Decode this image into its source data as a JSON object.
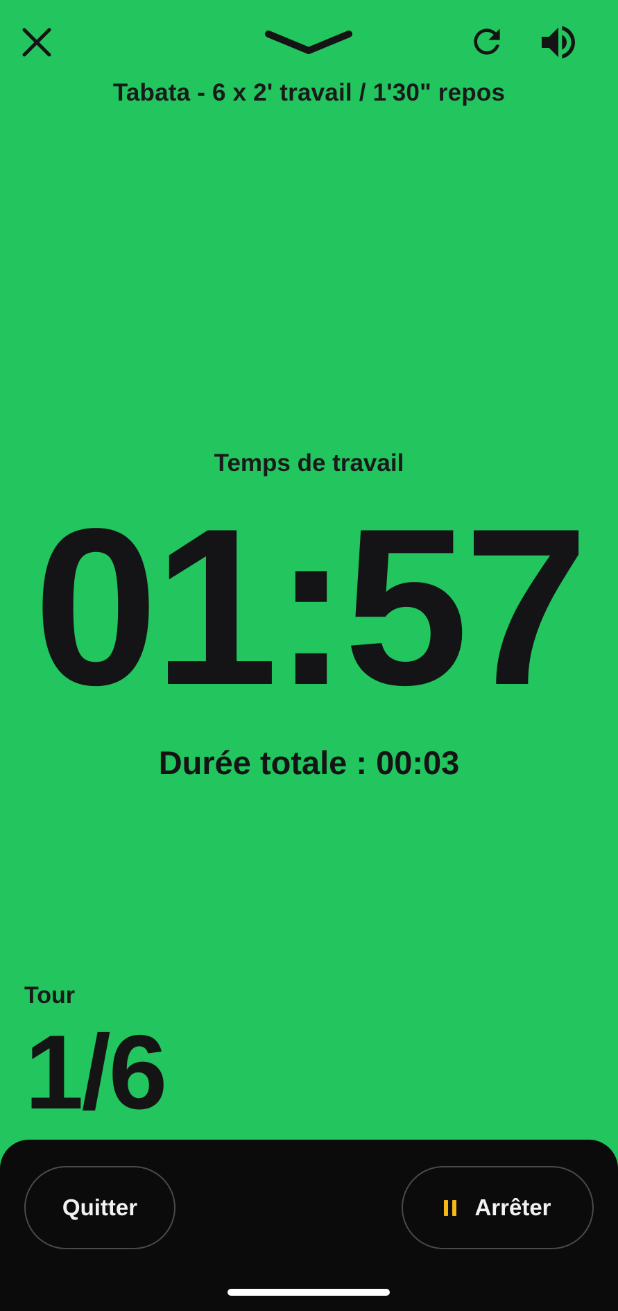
{
  "header": {
    "workout_title": "Tabata - 6 x 2' travail / 1'30\" repos",
    "icons": {
      "close": "close-icon",
      "collapse": "chevron-down-icon",
      "restart": "restart-icon",
      "sound": "volume-icon"
    }
  },
  "timer": {
    "phase_label": "Temps de travail",
    "time_remaining": "01:57",
    "total_duration": "Durée totale : 00:03"
  },
  "round": {
    "label": "Tour",
    "value": "1/6"
  },
  "controls": {
    "quit_label": "Quitter",
    "stop_label": "Arrêter"
  },
  "colors": {
    "background": "#22c55e",
    "text": "#141414",
    "bottom_bar": "#0b0b0b",
    "pause_accent": "#f5b915"
  }
}
